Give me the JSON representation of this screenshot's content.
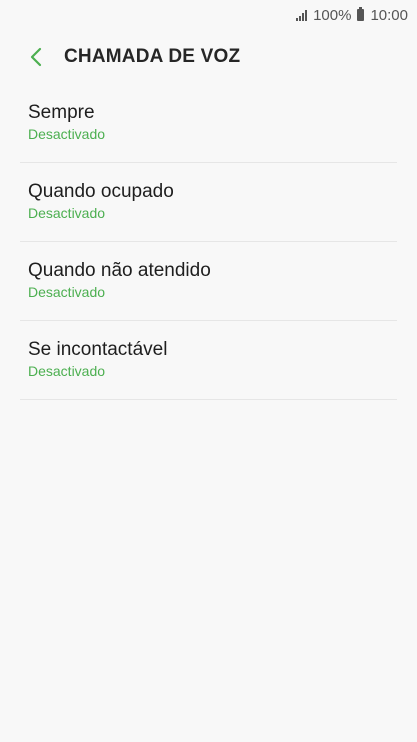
{
  "status_bar": {
    "battery": "100%",
    "time": "10:00",
    "signal_icon": "signal-icon",
    "battery_icon": "battery-icon"
  },
  "header": {
    "back_icon": "chevron-left-icon",
    "title": "CHAMADA DE VOZ"
  },
  "colors": {
    "accent": "#4caf50",
    "background": "#f8f8f8",
    "divider": "#e6e6e6"
  },
  "items": [
    {
      "title": "Sempre",
      "status": "Desactivado"
    },
    {
      "title": "Quando ocupado",
      "status": "Desactivado"
    },
    {
      "title": "Quando não atendido",
      "status": "Desactivado"
    },
    {
      "title": "Se incontactável",
      "status": "Desactivado"
    }
  ]
}
